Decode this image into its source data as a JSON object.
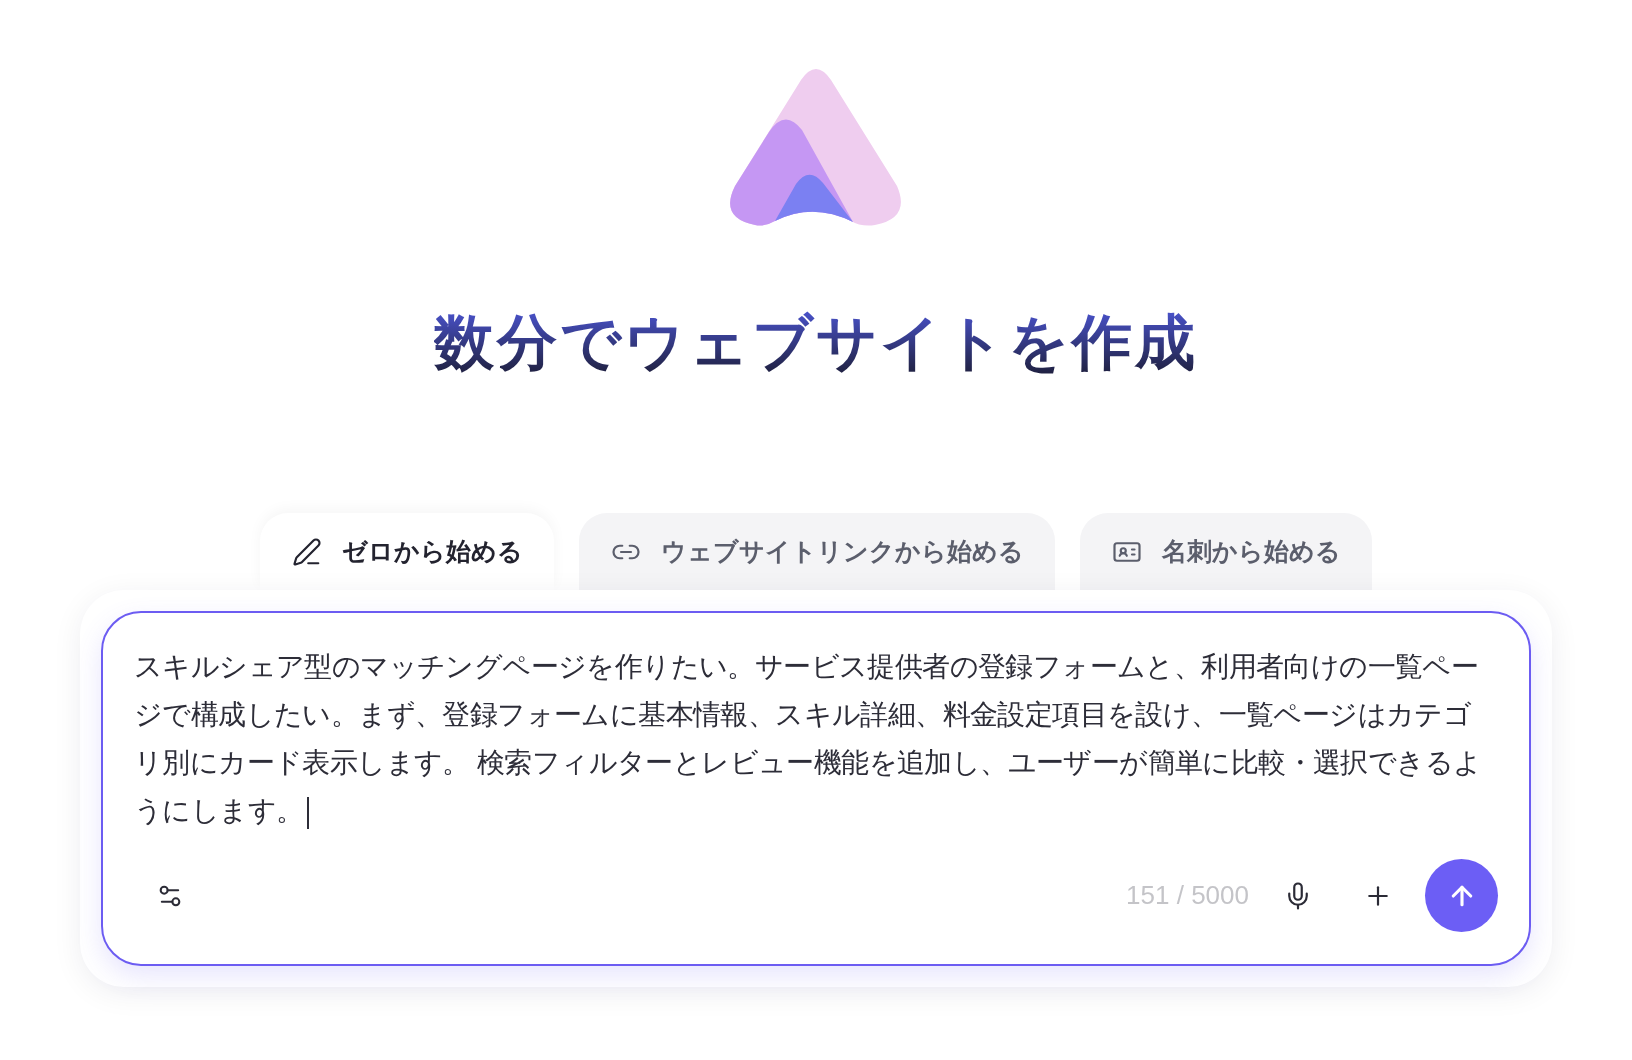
{
  "title": "数分でウェブサイトを作成",
  "tabs": [
    {
      "label": "ゼロから始める",
      "selected": true
    },
    {
      "label": "ウェブサイトリンクから始める",
      "selected": false
    },
    {
      "label": "名刺から始める",
      "selected": false
    }
  ],
  "prompt": {
    "value": "スキルシェア型のマッチングページを作りたい。サービス提供者の登録フォームと、利用者向けの一覧ページで構成したい。まず、登録フォームに基本情報、スキル詳細、料金設定項目を設け、一覧ページはカテゴリ別にカード表示します。 検索フィルターとレビュー機能を追加し、ユーザーが簡単に比較・選択できるようにします。",
    "char_count": "151 / 5000"
  }
}
